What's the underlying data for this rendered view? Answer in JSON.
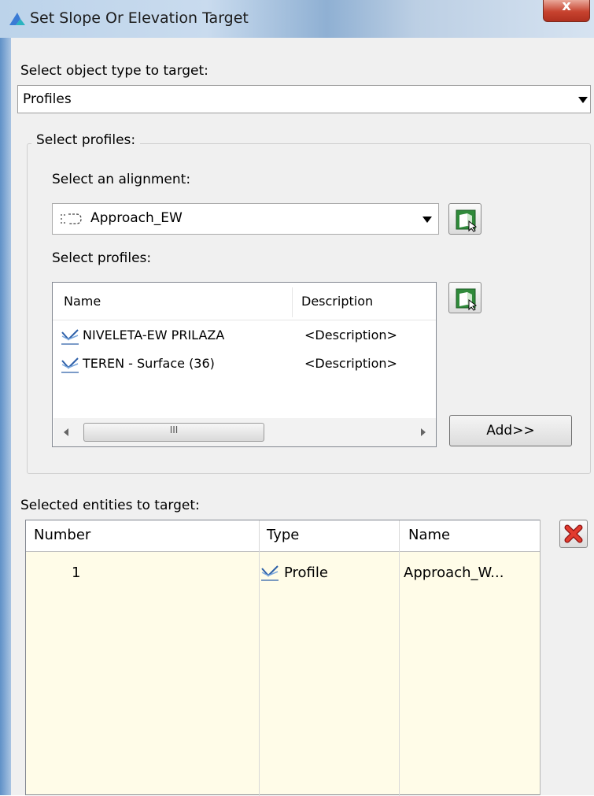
{
  "window": {
    "title": "Set Slope Or Elevation Target",
    "close_glyph": "x"
  },
  "object_type": {
    "label": "Select object type to target:",
    "value": "Profiles"
  },
  "profiles_group": {
    "legend": "Select profiles:",
    "alignment_label": "Select an alignment:",
    "alignment_value": "Approach_EW",
    "profiles_label": "Select profiles:",
    "columns": [
      "Name",
      "Description"
    ],
    "rows": [
      {
        "name": "NIVELETA-EW PRILAZA",
        "description": "<Description>"
      },
      {
        "name": "TEREN - Surface (36)",
        "description": "<Description>"
      }
    ],
    "scroll_grip": "III",
    "add_label": "Add>>"
  },
  "selected": {
    "label": "Selected entities to target:",
    "columns": [
      "Number",
      "Type",
      "Name"
    ],
    "rows": [
      {
        "number": "1",
        "type": "Profile",
        "name": "Approach_W..."
      }
    ]
  },
  "icons": {
    "app": "civil3d-app-icon",
    "alignment": "alignment-icon",
    "profile": "profile-icon",
    "pick": "pick-from-drawing-icon",
    "remove": "remove-red-x-icon"
  }
}
